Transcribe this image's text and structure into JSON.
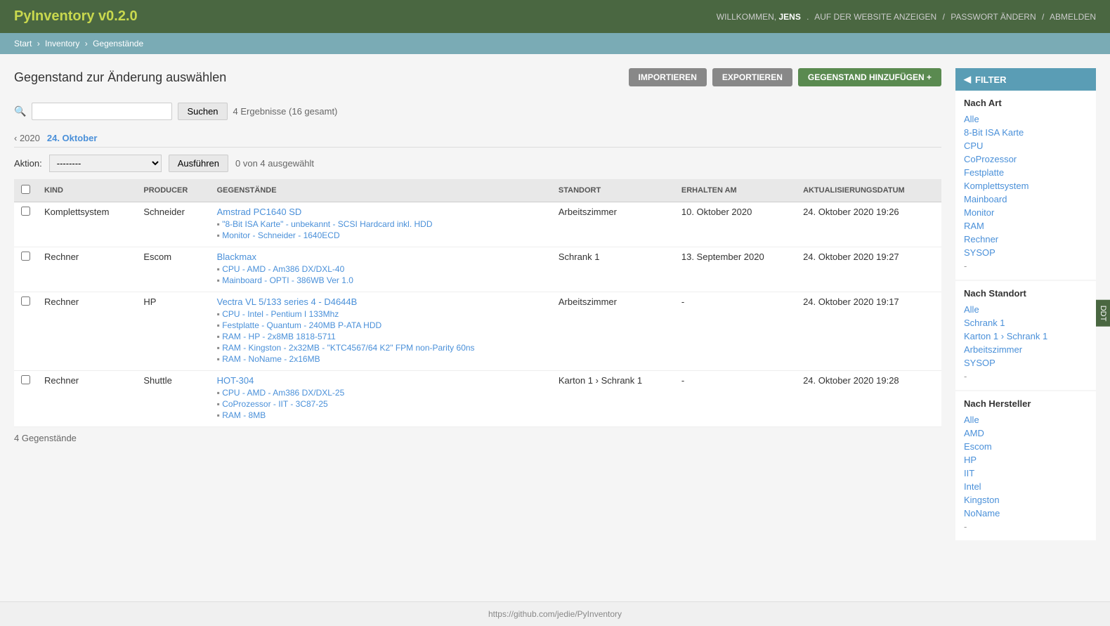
{
  "app": {
    "title": "PyInventory v0.2.0",
    "side_tab": "DDT"
  },
  "header": {
    "welcome": "WILLKOMMEN,",
    "username": "JENS",
    "links": {
      "website": "AUF DER WEBSITE ANZEIGEN",
      "password": "PASSWORT ÄNDERN",
      "logout": "ABMELDEN"
    }
  },
  "breadcrumb": {
    "start": "Start",
    "inventory": "Inventory",
    "current": "Gegenstände"
  },
  "page": {
    "title": "Gegenstand zur Änderung auswählen",
    "buttons": {
      "import": "IMPORTIEREN",
      "export": "EXPORTIEREN",
      "add": "GEGENSTAND HINZUFÜGEN +"
    }
  },
  "search": {
    "placeholder": "",
    "button": "Suchen",
    "results_text": "4 Ergebnisse (16 gesamt)"
  },
  "date_nav": {
    "prev": "‹ 2020",
    "current": "24. Oktober"
  },
  "action_bar": {
    "label": "Aktion:",
    "select_default": "--------",
    "button": "Ausführen",
    "selected": "0 von 4 ausgewählt"
  },
  "table": {
    "columns": [
      "KIND",
      "PRODUCER",
      "GEGENSTÄNDE",
      "STANDORT",
      "ERHALTEN AM",
      "AKTUALISIERUNGSDATUM"
    ],
    "rows": [
      {
        "kind": "Komplettsystem",
        "producer": "Schneider",
        "name": "Amstrad PC1640 SD",
        "sub_items": [
          "\"8-Bit ISA Karte\" - unbekannt - SCSI Hardcard inkl. HDD",
          "Monitor - Schneider - 1640ECD"
        ],
        "standort": "Arbeitszimmer",
        "erhalten": "10. Oktober 2020",
        "aktualisiert": "24. Oktober 2020 19:26"
      },
      {
        "kind": "Rechner",
        "producer": "Escom",
        "name": "Blackmax",
        "sub_items": [
          "CPU - AMD - Am386 DX/DXL-40",
          "Mainboard - OPTI - 386WB Ver 1.0"
        ],
        "standort": "Schrank 1",
        "erhalten": "13. September 2020",
        "aktualisiert": "24. Oktober 2020 19:27"
      },
      {
        "kind": "Rechner",
        "producer": "HP",
        "name": "Vectra VL 5/133 series 4 - D4644B",
        "sub_items": [
          "CPU - Intel - Pentium I 133Mhz",
          "Festplatte - Quantum - 240MB P-ATA HDD",
          "RAM - HP - 2x8MB 1818-5711",
          "RAM - Kingston - 2x32MB - \"KTC4567/64 K2\" FPM non-Parity 60ns",
          "RAM - NoName - 2x16MB"
        ],
        "standort": "Arbeitszimmer",
        "erhalten": "-",
        "aktualisiert": "24. Oktober 2020 19:17"
      },
      {
        "kind": "Rechner",
        "producer": "Shuttle",
        "name": "HOT-304",
        "sub_items": [
          "CPU - AMD - Am386 DX/DXL-25",
          "CoProzessor - IIT - 3C87-25",
          "RAM - 8MB"
        ],
        "standort": "Karton 1 › Schrank 1",
        "erhalten": "-",
        "aktualisiert": "24. Oktober 2020 19:28"
      }
    ],
    "footer": "4 Gegenstände"
  },
  "filter": {
    "title": "FILTER",
    "sections": [
      {
        "title": "Nach Art",
        "items": [
          "Alle",
          "8-Bit ISA Karte",
          "CPU",
          "CoProzessor",
          "Festplatte",
          "Komplettsystem",
          "Mainboard",
          "Monitor",
          "RAM",
          "Rechner",
          "SYSOP"
        ]
      },
      {
        "title": "Nach Standort",
        "items": [
          "Alle",
          "Schrank 1",
          "Karton 1 › Schrank 1",
          "Arbeitszimmer",
          "SYSOP"
        ]
      },
      {
        "title": "Nach Hersteller",
        "items": [
          "Alle",
          "AMD",
          "Escom",
          "HP",
          "IIT",
          "Intel",
          "Kingston",
          "NoName"
        ]
      }
    ]
  },
  "footer": {
    "url": "https://github.com/jedie/PyInventory"
  }
}
